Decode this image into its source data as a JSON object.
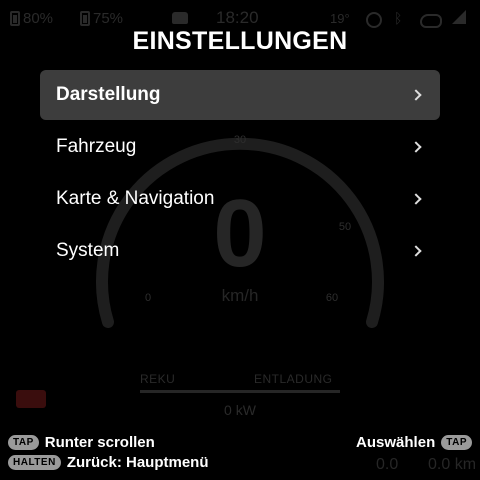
{
  "status_bar": {
    "phone_battery": "80%",
    "bike_battery": "75%",
    "time": "18:20",
    "temperature": "19°"
  },
  "dashboard": {
    "speed": "0",
    "unit": "km/h",
    "ticks": [
      "0",
      "30",
      "50",
      "60"
    ],
    "power_regen_label": "REKU",
    "power_discharge_label": "ENTLADUNG",
    "power_value": "0 kW",
    "trip_left": "0.0",
    "trip_right": "0.0 km"
  },
  "menu": {
    "title": "EINSTELLUNGEN",
    "items": [
      {
        "label": "Darstellung",
        "selected": true
      },
      {
        "label": "Fahrzeug",
        "selected": false
      },
      {
        "label": "Karte & Navigation",
        "selected": false
      },
      {
        "label": "System",
        "selected": false
      }
    ]
  },
  "hints": {
    "tap_key": "TAP",
    "tap_action": "Runter scrollen",
    "hold_key": "HALTEN",
    "hold_action": "Zurück: Hauptmenü",
    "select_action": "Auswählen",
    "select_key": "TAP"
  }
}
